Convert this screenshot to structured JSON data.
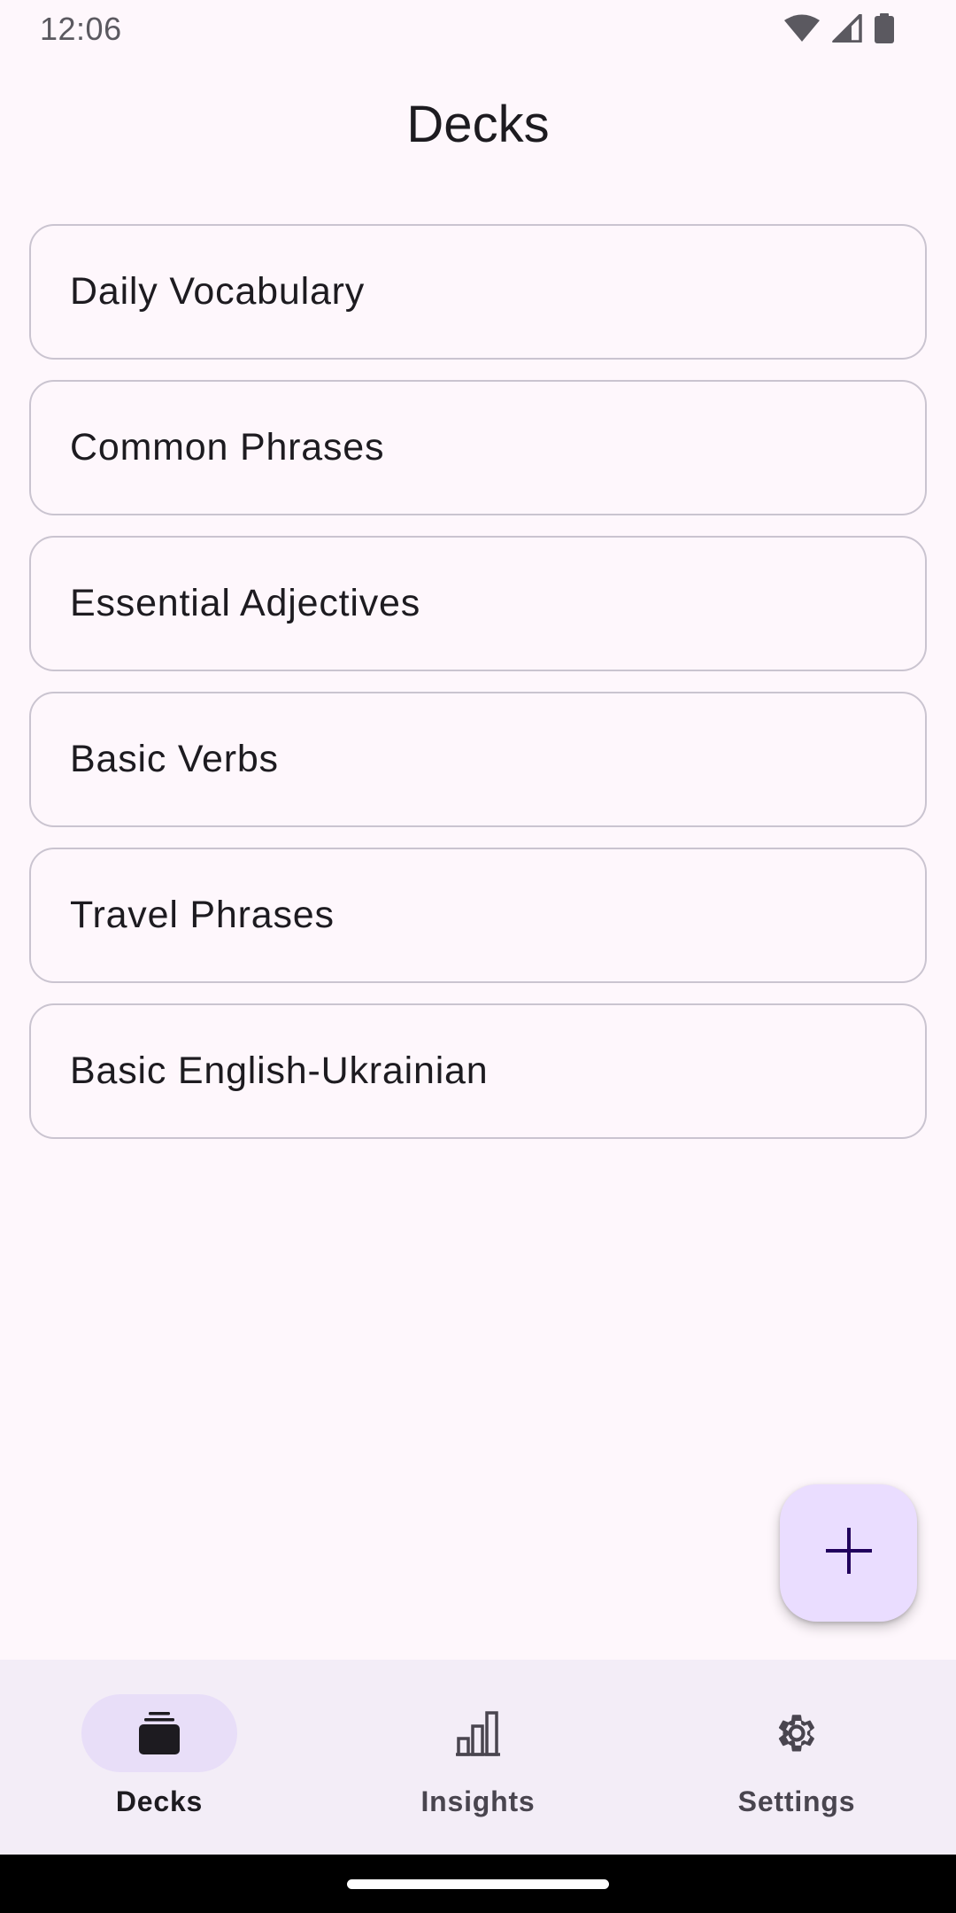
{
  "status_bar": {
    "time": "12:06",
    "icons": [
      "wifi-icon",
      "cellular-signal-icon",
      "battery-icon"
    ]
  },
  "app_bar": {
    "title": "Decks"
  },
  "decks": [
    {
      "name": "Daily Vocabulary"
    },
    {
      "name": "Common Phrases"
    },
    {
      "name": "Essential Adjectives"
    },
    {
      "name": "Basic Verbs"
    },
    {
      "name": "Travel Phrases"
    },
    {
      "name": "Basic English-Ukrainian"
    }
  ],
  "fab": {
    "icon": "plus-icon"
  },
  "bottom_nav": {
    "items": [
      {
        "label": "Decks",
        "icon": "decks-icon",
        "active": true
      },
      {
        "label": "Insights",
        "icon": "bar-chart-icon",
        "active": false
      },
      {
        "label": "Settings",
        "icon": "gear-icon",
        "active": false
      }
    ]
  },
  "colors": {
    "background": "#fef7fc",
    "card_border": "#cac4d0",
    "fab_container": "#eaddff",
    "nav_background": "#f3edf7",
    "nav_active_indicator": "#e8def8",
    "on_surface": "#1d1b20"
  }
}
